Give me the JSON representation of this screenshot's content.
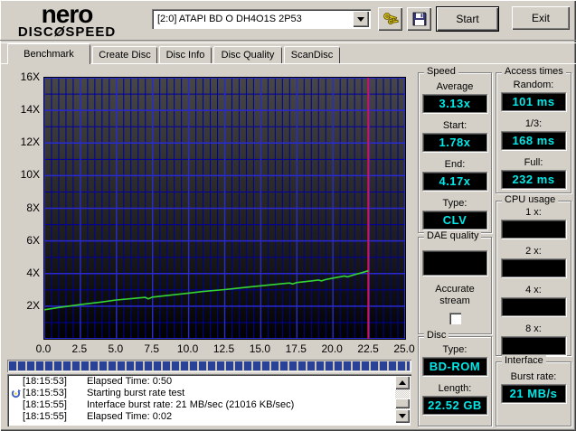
{
  "logo": {
    "line1": "nero",
    "disc_left": "DISC",
    "disc_glyph": "Ø",
    "disc_right": "SPEED"
  },
  "header": {
    "drive_selector_value": "[2:0]  ATAPI BD  O  DH4O1S 2P53",
    "start_label": "Start",
    "exit_label": "Exit"
  },
  "tabs": [
    {
      "label": "Benchmark",
      "active": true
    },
    {
      "label": "Create Disc",
      "active": false
    },
    {
      "label": "Disc Info",
      "active": false
    },
    {
      "label": "Disc Quality",
      "active": false
    },
    {
      "label": "ScanDisc",
      "active": false
    }
  ],
  "chart_data": {
    "type": "line",
    "title": "",
    "xlabel": "",
    "ylabel": "",
    "xlim": [
      0,
      25
    ],
    "ylim": [
      0,
      16
    ],
    "x_tick_values": [
      0,
      2.5,
      5,
      7.5,
      10,
      12.5,
      15,
      17.5,
      20,
      22.5,
      25
    ],
    "x_tick_labels": [
      "0.0",
      "2.5",
      "5.0",
      "7.5",
      "10.0",
      "12.5",
      "15.0",
      "17.5",
      "20.0",
      "22.5",
      "25.0"
    ],
    "y_tick_values": [
      2,
      4,
      6,
      8,
      10,
      12,
      14,
      16
    ],
    "y_tick_labels": [
      "2X",
      "4X",
      "6X",
      "8X",
      "10X",
      "12X",
      "14X",
      "16X"
    ],
    "x_minor_step": 0.5,
    "x_major_step": 2.5,
    "y_minor_step": 1,
    "y_major_step": 2,
    "grid_minor_color": "#0000a0",
    "grid_major_color": "#2929d6",
    "bg_gradient_top": "#474747",
    "bg_gradient_bottom": "#000000",
    "series": [
      {
        "name": "read-speed",
        "color": "#35d435",
        "points": [
          [
            0,
            1.78
          ],
          [
            1,
            1.92
          ],
          [
            2.5,
            2.1
          ],
          [
            4,
            2.26
          ],
          [
            5,
            2.38
          ],
          [
            6.5,
            2.5
          ],
          [
            7,
            2.54
          ],
          [
            7.2,
            2.45
          ],
          [
            7.5,
            2.56
          ],
          [
            9,
            2.7
          ],
          [
            10,
            2.8
          ],
          [
            11,
            2.9
          ],
          [
            12.5,
            3.02
          ],
          [
            14,
            3.16
          ],
          [
            15,
            3.25
          ],
          [
            16.5,
            3.38
          ],
          [
            17,
            3.42
          ],
          [
            17.2,
            3.36
          ],
          [
            17.5,
            3.45
          ],
          [
            18.5,
            3.55
          ],
          [
            19,
            3.6
          ],
          [
            19.2,
            3.55
          ],
          [
            19.5,
            3.63
          ],
          [
            20,
            3.72
          ],
          [
            20.8,
            3.85
          ],
          [
            21,
            3.8
          ],
          [
            21.5,
            3.93
          ],
          [
            22,
            4.05
          ],
          [
            22.45,
            4.17
          ]
        ]
      }
    ],
    "marker_line": {
      "x": 22.45,
      "color": "#cc1166"
    },
    "legend": "none"
  },
  "panels": {
    "speed": {
      "title": "Speed",
      "fields": [
        {
          "label": "Average",
          "value": "3.13x"
        },
        {
          "label": "Start:",
          "value": "1.78x"
        },
        {
          "label": "End:",
          "value": "4.17x"
        },
        {
          "label": "Type:",
          "value": "CLV"
        }
      ]
    },
    "access_times": {
      "title": "Access times",
      "fields": [
        {
          "label": "Random:",
          "value": "101 ms"
        },
        {
          "label": "1/3:",
          "value": "168 ms"
        },
        {
          "label": "Full:",
          "value": "232 ms"
        }
      ]
    },
    "dae_quality": {
      "title": "DAE quality",
      "display_value": "",
      "checkbox_label": "Accurate stream",
      "checkbox_checked": false
    },
    "cpu_usage": {
      "title": "CPU usage",
      "fields": [
        {
          "label": "1 x:",
          "value": ""
        },
        {
          "label": "2 x:",
          "value": ""
        },
        {
          "label": "4 x:",
          "value": ""
        },
        {
          "label": "8 x:",
          "value": ""
        }
      ]
    },
    "disc": {
      "title": "Disc",
      "fields": [
        {
          "label": "Type:",
          "value": "BD-ROM"
        },
        {
          "label": "Length:",
          "value": "22.52 GB"
        }
      ]
    },
    "interface": {
      "title": "Interface",
      "fields": [
        {
          "label": "Burst rate:",
          "value": "21 MB/s"
        }
      ]
    }
  },
  "progress": {
    "percent_filled": 100
  },
  "log": {
    "entries": [
      {
        "time": "[18:15:53]",
        "text": "Elapsed Time:  0:50",
        "icon": false
      },
      {
        "time": "[18:15:53]",
        "text": "Starting burst rate test",
        "icon": true
      },
      {
        "time": "[18:15:55]",
        "text": "Interface burst rate: 21 MB/sec (21016 KB/sec)",
        "icon": false
      },
      {
        "time": "[18:15:55]",
        "text": "Elapsed Time:  0:02",
        "icon": false
      }
    ]
  }
}
